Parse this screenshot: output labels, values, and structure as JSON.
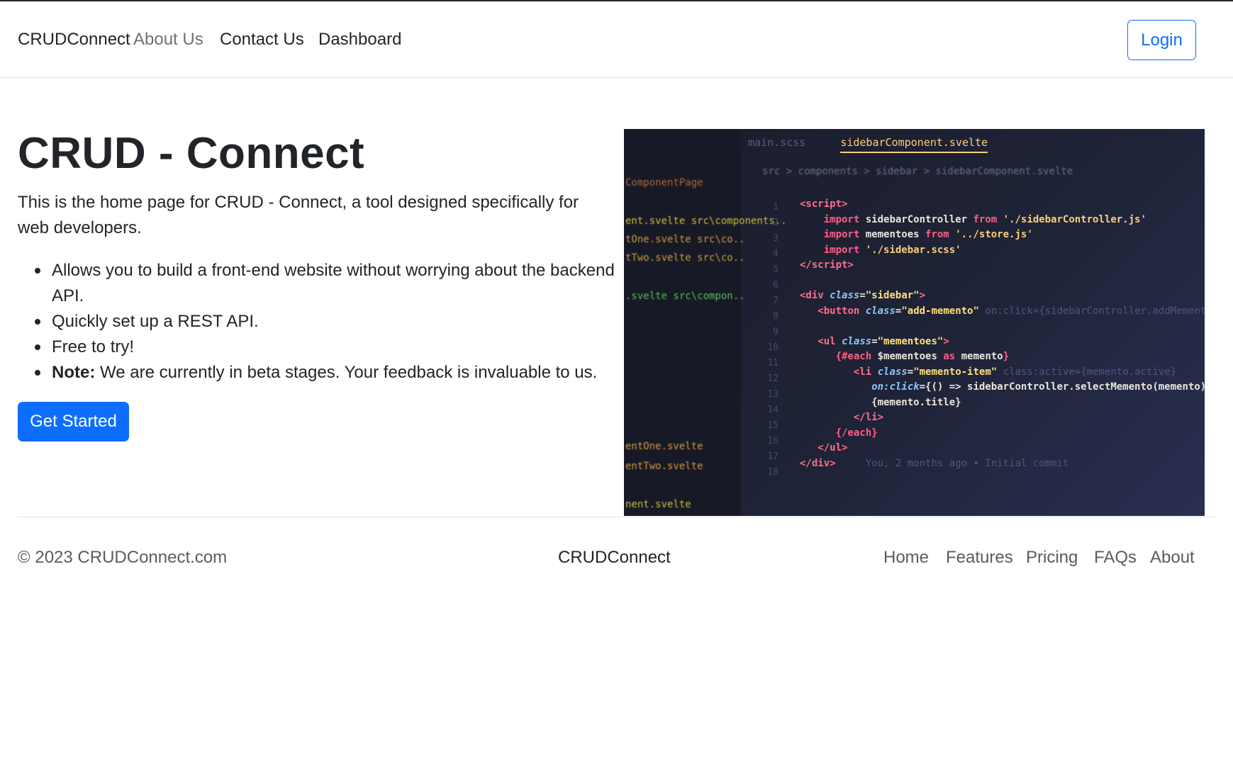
{
  "navbar": {
    "brand": "CRUDConnect",
    "links": [
      "About Us",
      "Contact Us",
      "Dashboard"
    ],
    "login_label": "Login"
  },
  "hero": {
    "title": "CRUD - Connect",
    "description": "This is the home page for CRUD - Connect, a tool designed specifically for web developers.",
    "features": [
      "Allows you to build a front-end website without worrying about the backend API.",
      "Quickly set up a REST API.",
      "Free to try!"
    ],
    "note_label": "Note:",
    "note_text": " We are currently in beta stages. Your feedback is invaluable to us.",
    "cta_label": "Get Started"
  },
  "hero_image": {
    "tabs": [
      "main.scss",
      "sidebarComponent.svelte"
    ],
    "breadcrumb": "src > components > sidebar > sidebarComponent.svelte",
    "sidebar_files": [
      {
        "text": "ComponentPage",
        "color": "#b8693a"
      },
      {
        "text": "ent.svelte  src\\components..",
        "color": "#d8c53a"
      },
      {
        "text": "tOne.svelte  src\\co..",
        "color": "#d8a03a"
      },
      {
        "text": "tTwo.svelte  src\\co..",
        "color": "#d8a03a"
      },
      {
        "text": ".svelte  src\\compon..",
        "color": "#5cc65c"
      },
      {
        "text": "entOne.svelte",
        "color": "#d8a03a"
      },
      {
        "text": "entTwo.svelte",
        "color": "#d8a03a"
      },
      {
        "text": "nent.svelte",
        "color": "#d8c53a"
      }
    ],
    "line_numbers": "1\n2\n3\n4\n5\n6\n7\n8\n9\n10\n11\n12\n13\n14\n15\n16\n17\n18",
    "blame": "You, 2 months ago • Initial commit"
  },
  "footer": {
    "copyright": "© 2023 CRUDConnect.com",
    "brand": "CRUDConnect",
    "links": [
      "Home",
      "Features",
      "Pricing",
      "FAQs",
      "About"
    ]
  },
  "colors": {
    "primary": "#0d6efd",
    "text": "#212529",
    "muted": "#6c757d",
    "border": "#dee2e6"
  }
}
